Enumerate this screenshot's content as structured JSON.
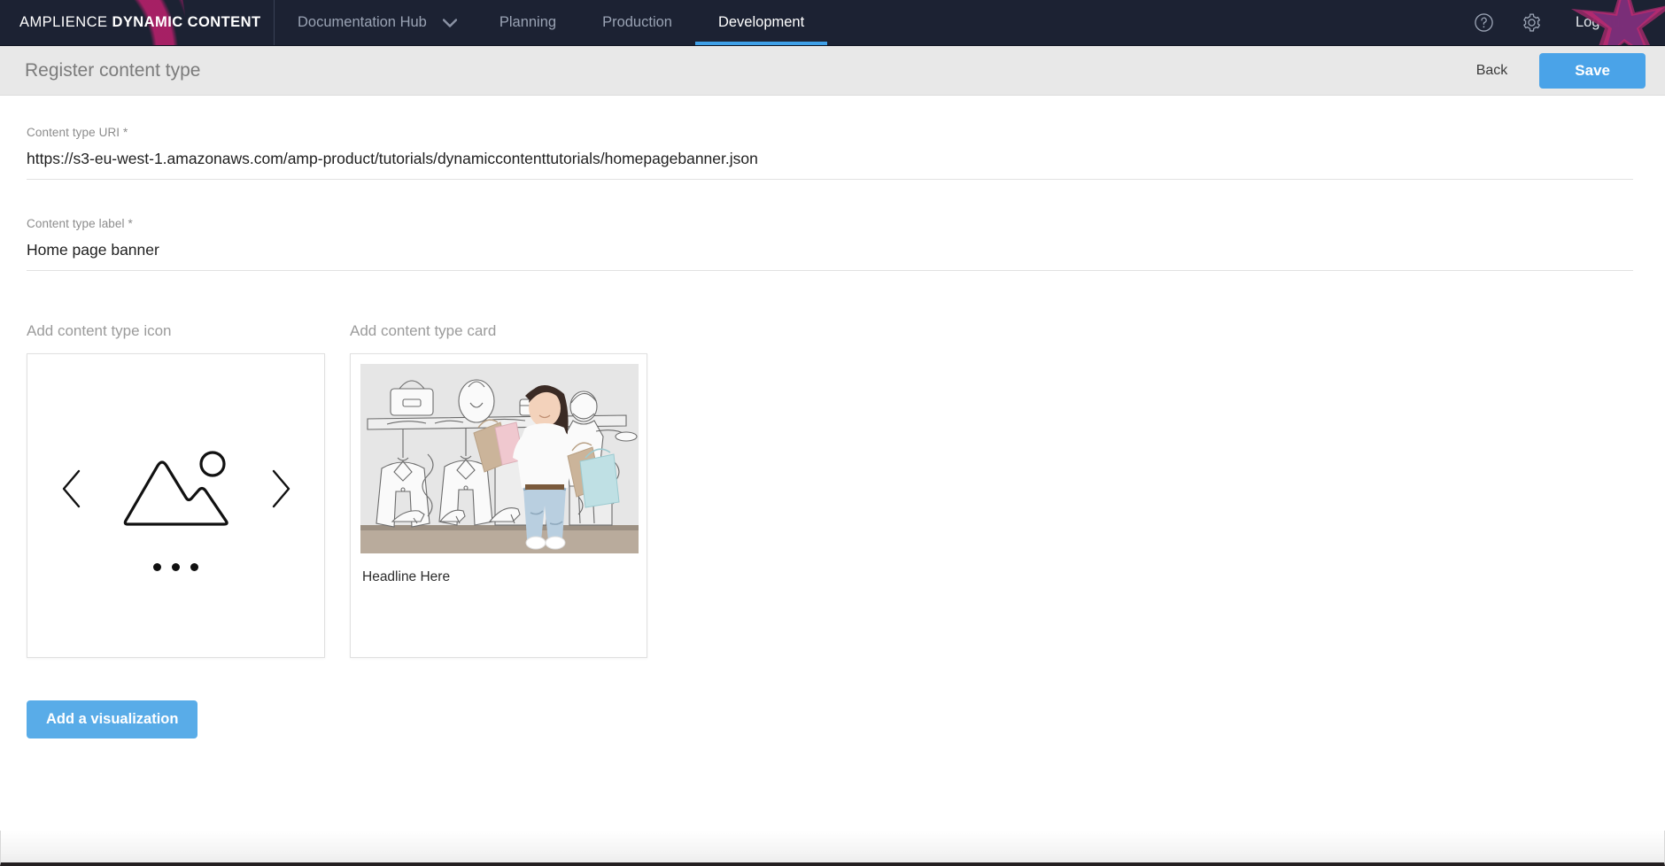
{
  "topbar": {
    "brand_prefix": "AMPLIENCE ",
    "brand_bold": "DYNAMIC CONTENT",
    "hub_label": "Documentation Hub",
    "caret_icon": "chevron-down-icon",
    "tabs": [
      {
        "label": "Planning",
        "active": false
      },
      {
        "label": "Production",
        "active": false
      },
      {
        "label": "Development",
        "active": true
      }
    ],
    "help_icon": "help-circle-icon",
    "settings_icon": "gear-icon",
    "logout_label": "Log out",
    "active_tab_color": "#3fa0e8"
  },
  "subheader": {
    "title": "Register content type",
    "back_label": "Back",
    "save_label": "Save",
    "save_color": "#4aa3e8"
  },
  "form": {
    "uri": {
      "label": "Content type URI *",
      "value": "https://s3-eu-west-1.amazonaws.com/amp-product/tutorials/dynamiccontenttutorials/homepagebanner.json",
      "placeholder": "Content type URI"
    },
    "label_field": {
      "label": "Content type label *",
      "value": "Home page banner",
      "placeholder": "Content type label"
    }
  },
  "visualizations": {
    "icon_section_label": "Add content type icon",
    "card_section_label": "Add content type card",
    "icon_placeholder": "image-placeholder-icon",
    "prev_icon": "chevron-left-icon",
    "next_icon": "chevron-right-icon",
    "pager_dots": 3,
    "card_headline": "Headline Here",
    "card_image_alt": "woman-with-shopping-bags-illustration",
    "add_button_label": "Add a visualization",
    "add_button_color": "#59ace8"
  }
}
